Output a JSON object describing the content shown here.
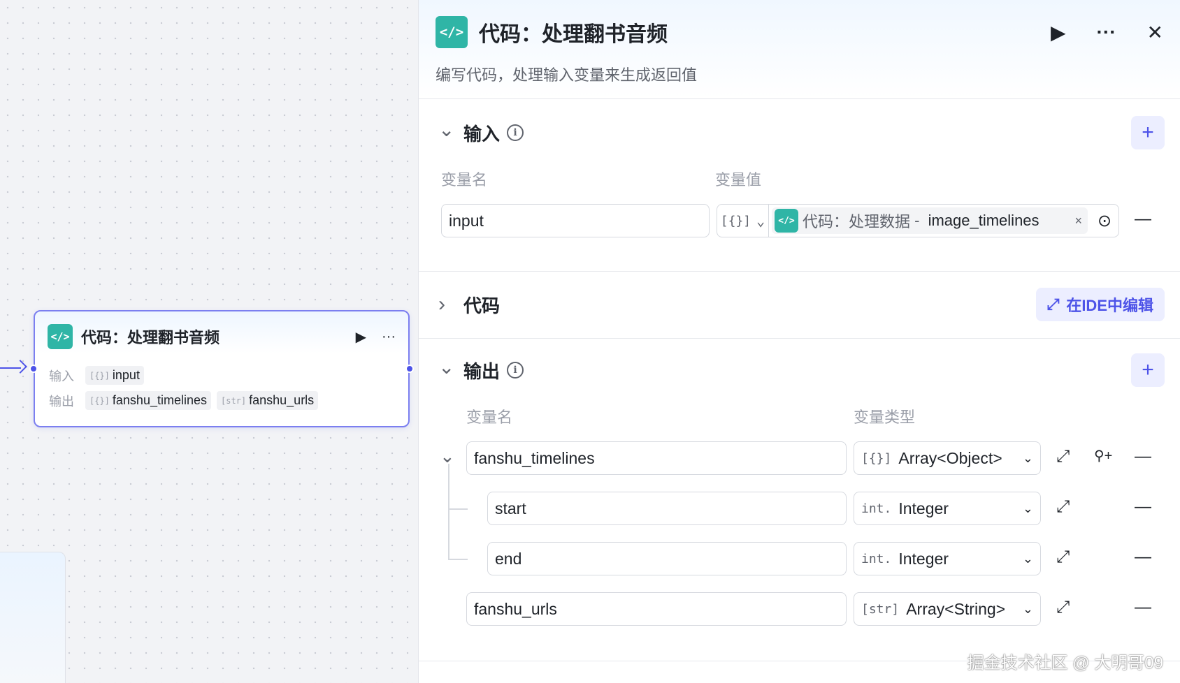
{
  "node": {
    "title": "代码：处理翻书音频",
    "input_label": "输入",
    "output_label": "输出",
    "inputs": [
      {
        "type": "[{}]",
        "name": "input"
      }
    ],
    "outputs": [
      {
        "type": "[{}]",
        "name": "fanshu_timelines"
      },
      {
        "type": "[str]",
        "name": "fanshu_urls"
      }
    ]
  },
  "panel": {
    "title": "代码：处理翻书音频",
    "description": "编写代码，处理输入变量来生成返回值",
    "input_section": {
      "title": "输入",
      "col_name": "变量名",
      "col_value": "变量值",
      "rows": [
        {
          "name": "input",
          "ref_type": "[{}]",
          "ref_node": "代码：处理数据",
          "ref_sep": " - ",
          "ref_var": "image_timelines"
        }
      ]
    },
    "code_section": {
      "title": "代码",
      "ide_button": "在IDE中编辑"
    },
    "output_section": {
      "title": "输出",
      "col_name": "变量名",
      "col_type": "变量类型",
      "rows": [
        {
          "name": "fanshu_timelines",
          "type_icon": "[{}]",
          "type": "Array<Object>"
        },
        {
          "name": "start",
          "type_icon": "int.",
          "type": "Integer"
        },
        {
          "name": "end",
          "type_icon": "int.",
          "type": "Integer"
        },
        {
          "name": "fanshu_urls",
          "type_icon": "[str]",
          "type": "Array<String>"
        }
      ]
    }
  },
  "icons": {
    "code": "</>",
    "run": "▶",
    "more": "···",
    "close": "✕",
    "plus": "+",
    "minus": "—",
    "expand": "⤢",
    "chevron_down": "⌄",
    "chevron_right": "›",
    "info": "i",
    "clear": "×",
    "target": "⊙",
    "add_child": "⚲+"
  },
  "watermark": "掘金技术社区 @ 大明哥09",
  "colors": {
    "accent": "#4d53e8",
    "code_badge": "#2fb5a6"
  }
}
